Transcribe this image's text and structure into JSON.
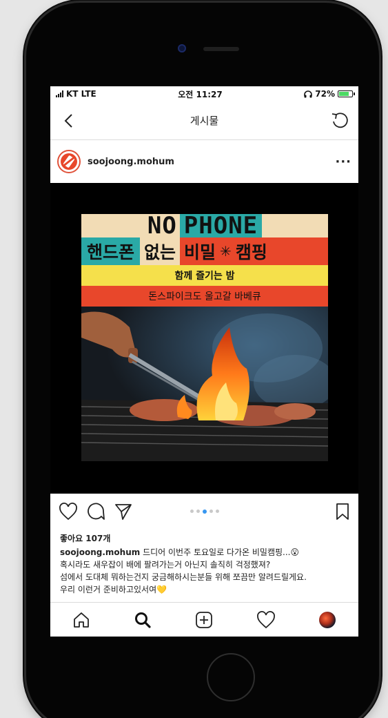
{
  "status_bar": {
    "carrier": "KT LTE",
    "time": "오전 11:27",
    "battery": "72%"
  },
  "nav": {
    "title": "게시물"
  },
  "post": {
    "username": "soojoong.mohum",
    "more_label": "···",
    "poster": {
      "title_no": "NO",
      "title_phone": "PHONE",
      "sub_a": "핸드폰",
      "sub_b": "없는",
      "sub_c": "비밀",
      "sub_star": "✳",
      "sub_d": "캠핑",
      "line_yellow": "함께 즐기는 밤",
      "line_red": "돈스파이크도 울고갈 바베큐"
    },
    "carousel": {
      "count": 5,
      "active_index": 2
    },
    "likes": "좋아요 107개",
    "caption": {
      "author": "soojoong.mohum",
      "line1": " 드디어 이번주 토요일로 다가온 비밀캠핑...😮",
      "line2": "혹시라도 새우잡이 배에 팔려가는거 아닌지 솔직히 걱정했져?",
      "line3": "섬에서 도대체 뭐하는건지 궁금해하시는분들 위해 쪼끔만 알려드릴게요.",
      "line4": "우리 이런거 준비하고있서여💛"
    }
  },
  "colors": {
    "teal": "#2aa9a6",
    "cream": "#f2dcb5",
    "red": "#e8472b",
    "yellow": "#f5e04b",
    "active_dot": "#3897f0"
  },
  "icons": {
    "back": "chevron-left-icon",
    "refresh": "refresh-icon",
    "like": "heart-icon",
    "comment": "comment-icon",
    "share": "paper-plane-icon",
    "save": "bookmark-icon",
    "home": "home-icon",
    "search": "search-icon",
    "add": "add-post-icon",
    "activity": "heart-icon"
  }
}
